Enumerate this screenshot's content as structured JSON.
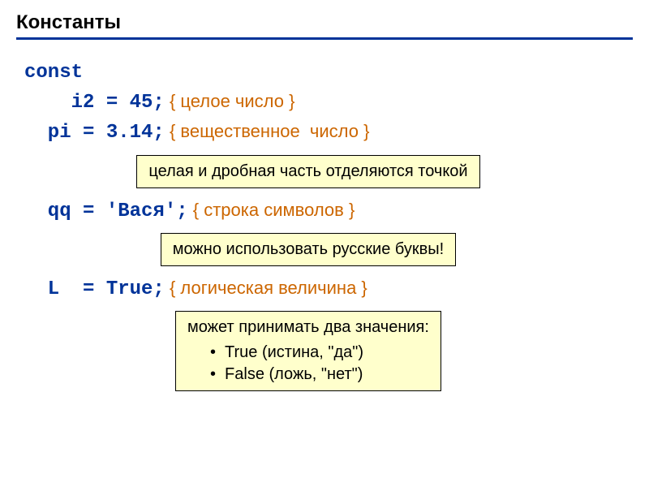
{
  "title": "Константы",
  "code": {
    "keyword": "const",
    "line1_lhs": "    i2 = 45;",
    "line1_comment": " { целое число }",
    "line2_lhs": "  pi = 3.14;",
    "line2_comment": " { вещественное  число }",
    "note1": "целая и дробная часть отделяются точкой",
    "line3_lhs": "  qq = 'Вася';",
    "line3_comment": " { строка символов }",
    "note2": "можно использовать русские буквы!",
    "line4_lhs": "  L  = True;",
    "line4_comment": " { логическая величина }",
    "note3_head": "может принимать два значения:",
    "note3_b1": "True (истина, \"да\")",
    "note3_b2": "False (ложь, \"нет\")"
  }
}
